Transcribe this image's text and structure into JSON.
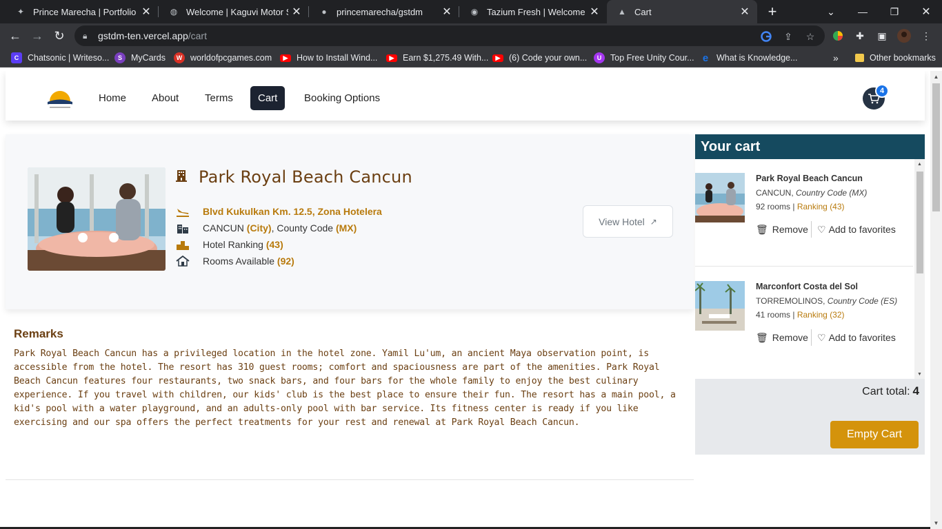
{
  "browser": {
    "tabs": [
      {
        "title": "Prince Marecha | Portfolio",
        "icon": "wolf-icon"
      },
      {
        "title": "Welcome | Kaguvi Motor Spa",
        "icon": "globe-icon"
      },
      {
        "title": "princemarecha/gstdm",
        "icon": "github-icon"
      },
      {
        "title": "Tazium Fresh | Welcome",
        "icon": "circle-icon"
      },
      {
        "title": "Cart",
        "icon": "triangle-icon"
      }
    ],
    "active_tab": 4,
    "url_host": "gstdm-ten.vercel.app",
    "url_path": "/cart",
    "bookmarks": [
      {
        "label": "Chatsonic | Writeso...",
        "color": "#5b3df5"
      },
      {
        "label": "MyCards",
        "color": "#7a3fbf"
      },
      {
        "label": "worldofpcgames.com",
        "color": "#d93025"
      },
      {
        "label": "How to Install Wind...",
        "color": "#ff0000"
      },
      {
        "label": "Earn $1,275.49 With...",
        "color": "#ff0000"
      },
      {
        "label": "(6) Code your own...",
        "color": "#ff0000"
      },
      {
        "label": "Top Free Unity Cour...",
        "color": "#a435f0"
      },
      {
        "label": "What is Knowledge...",
        "color": "#1a73e8"
      }
    ],
    "bookmarks_overflow": "»",
    "other_bookmarks": "Other bookmarks"
  },
  "nav": {
    "links": [
      "Home",
      "About",
      "Terms",
      "Cart",
      "Booking Options"
    ],
    "active": "Cart",
    "cart_count": "4"
  },
  "hotel": {
    "name": "Park Royal Beach Cancun",
    "address": "Blvd Kukulkan Km. 12.5, Zona Hotelera",
    "city": "CANCUN",
    "city_label": "(City)",
    "county_text": ", County Code",
    "county_code": "(MX)",
    "ranking_label": "Hotel Ranking",
    "ranking": "(43)",
    "rooms_label": "Rooms Available",
    "rooms": "(92)",
    "view_button": "View Hotel"
  },
  "remarks": {
    "title": "Remarks",
    "text": "Park Royal Beach Cancun has a privileged location in the hotel zone. Yamil Lu'um, an ancient Maya observation point, is accessible from the hotel. The resort has 310 guest rooms; comfort and spaciousness are part of the amenities. Park Royal Beach Cancun features four restaurants, two snack bars, and four bars for the whole family to enjoy the best culinary experience. If you travel with children, our kids' club is the best place to ensure their fun. The resort has a main pool, a kid's pool with a water playground, and an adults-only pool with bar service. Its fitness center is ready if you like exercising and our spa offers the perfect treatments for your rest and renewal at Park Royal Beach Cancun."
  },
  "cart": {
    "title": "Your cart",
    "items": [
      {
        "name": "Park Royal Beach Cancun",
        "city": "CANCUN",
        "country": "Country Code (MX)",
        "rooms": "92 rooms",
        "ranking": "Ranking (43)",
        "remove": "Remove",
        "favorite": "Add to favorites"
      },
      {
        "name": "Marconfort Costa del Sol",
        "city": "TORREMOLINOS",
        "country": "Country Code (ES)",
        "rooms": "41 rooms",
        "ranking": "Ranking (32)",
        "remove": "Remove",
        "favorite": "Add to favorites"
      }
    ],
    "total_label": "Cart total:",
    "total": "4",
    "empty_button": "Empty Cart"
  }
}
